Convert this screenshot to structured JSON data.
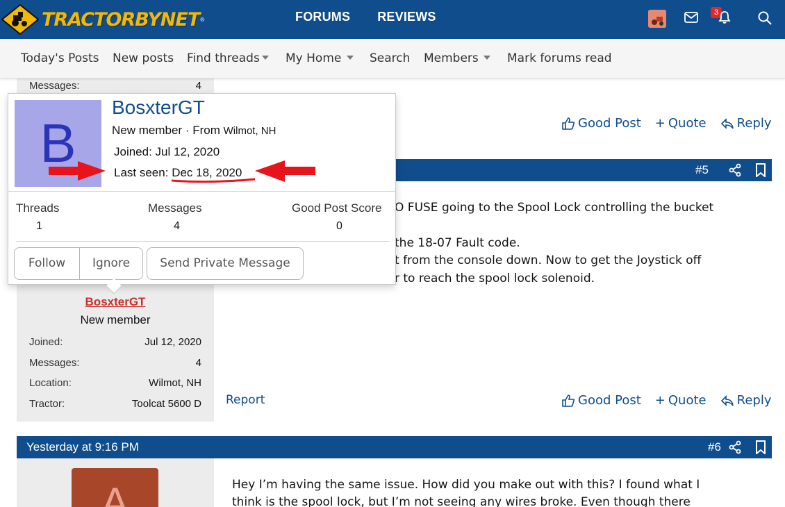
{
  "header": {
    "logo_text": "TRACTORBYNET",
    "logo_reg": "®",
    "nav": [
      "FORUMS",
      "REVIEWS"
    ],
    "alert_count": "3",
    "colors": {
      "brand_blue": "#0f4d8c",
      "logo_yellow": "#f5b800",
      "badge_red": "#e02828"
    }
  },
  "subnav": {
    "items": [
      "Today's Posts",
      "New posts",
      "Find threads",
      "My Home",
      "Search",
      "Members",
      "Mark forums read"
    ]
  },
  "prev_post": {
    "messages_label": "Messages:",
    "messages_value": "4"
  },
  "actions": {
    "good_post": "Good Post",
    "quote": "Quote",
    "reply": "Reply",
    "report": "Report"
  },
  "post5": {
    "number": "#5",
    "lines": [
      "O FUSE going to the Spool Lock controlling the bucket",
      "the 18-07 Fault code.",
      "t from the console down. Now to get the Joystick off",
      "r to reach the spool lock solenoid."
    ],
    "user": {
      "name": "BosxterGT",
      "title": "New member",
      "info": [
        {
          "k": "Joined:",
          "v": "Jul 12, 2020"
        },
        {
          "k": "Messages:",
          "v": "4"
        },
        {
          "k": "Location:",
          "v": "Wilmot, NH"
        },
        {
          "k": "Tractor:",
          "v": "Toolcat 5600 D"
        }
      ]
    }
  },
  "post6": {
    "date": "Yesterday at 9:16 PM",
    "number": "#6",
    "avatar_letter": "A",
    "lines": [
      "Hey I’m having the same issue. How did you make out with this? I found what I",
      "think is the spool lock, but I’m not seeing any wires broke. Even though there"
    ]
  },
  "popup": {
    "avatar_letter": "B",
    "name": "BosxterGT",
    "title": "New member",
    "from_label": "From",
    "from_value": "Wilmot, NH",
    "joined": "Joined: Jul 12, 2020",
    "last_seen_label": "Last seen:",
    "last_seen_value": "Dec 18, 2020",
    "stats": [
      {
        "label": "Threads",
        "value": "1"
      },
      {
        "label": "Messages",
        "value": "4"
      },
      {
        "label": "Good Post Score",
        "value": "0"
      }
    ],
    "buttons": {
      "follow": "Follow",
      "ignore": "Ignore",
      "message": "Send Private Message"
    }
  }
}
